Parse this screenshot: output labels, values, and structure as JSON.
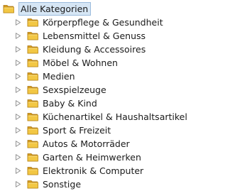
{
  "tree": {
    "root": {
      "label": "Alle Kategorien",
      "icon": "folder-icon"
    },
    "expander_icon": "expand-triangle-icon",
    "folder_color": "#e8b830",
    "selection_color": "#d6e6f5",
    "children": [
      {
        "label": "Körperpflege & Gesundheit"
      },
      {
        "label": "Lebensmittel & Genuss"
      },
      {
        "label": "Kleidung & Accessoires"
      },
      {
        "label": "Möbel & Wohnen"
      },
      {
        "label": "Medien"
      },
      {
        "label": "Sexspielzeuge"
      },
      {
        "label": "Baby & Kind"
      },
      {
        "label": "Küchenartikel & Haushaltsartikel"
      },
      {
        "label": "Sport & Freizeit"
      },
      {
        "label": "Autos & Motorräder"
      },
      {
        "label": "Garten & Heimwerken"
      },
      {
        "label": "Elektronik & Computer"
      },
      {
        "label": "Sonstige"
      }
    ]
  }
}
